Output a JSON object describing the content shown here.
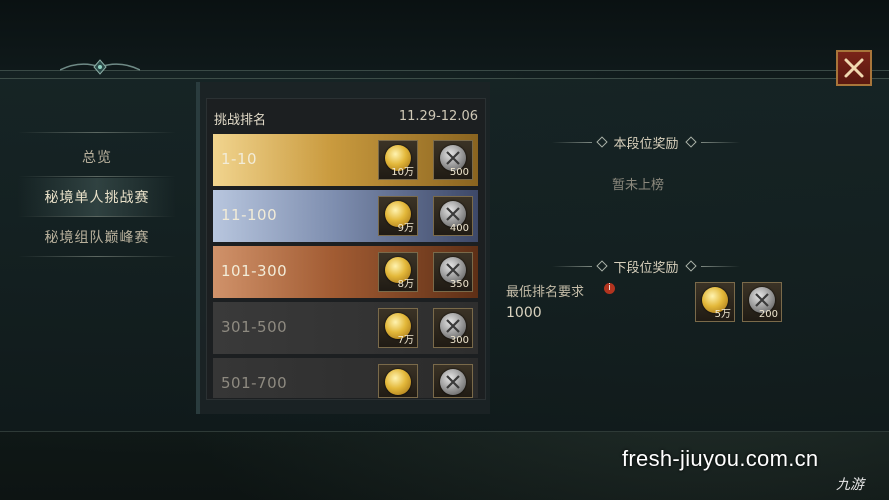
{
  "sidebar": {
    "items": [
      {
        "label": "总览",
        "active": false
      },
      {
        "label": "秘境单人挑战赛",
        "active": true
      },
      {
        "label": "秘境组队巅峰赛",
        "active": false
      }
    ]
  },
  "ranking": {
    "header_title": "挑战排名",
    "date_range": "11.29-12.06",
    "rows": [
      {
        "range": "1-10",
        "gold": "10万",
        "medal": "500"
      },
      {
        "range": "11-100",
        "gold": "9万",
        "medal": "400"
      },
      {
        "range": "101-300",
        "gold": "8万",
        "medal": "350"
      },
      {
        "range": "301-500",
        "gold": "7万",
        "medal": "300"
      },
      {
        "range": "501-700",
        "gold": "",
        "medal": ""
      }
    ]
  },
  "current_tier": {
    "title": "本段位奖励",
    "status": "暂未上榜"
  },
  "next_tier": {
    "title": "下段位奖励",
    "requirement_label": "最低排名要求",
    "info_icon": "i",
    "requirement_value": "1000",
    "gold": "5万",
    "medal": "200"
  },
  "close_icon": "close-icon",
  "watermark": {
    "url": "fresh-jiuyou.com.cn",
    "logo": "九游"
  },
  "colors": {
    "gold_tier": "#c99a3e",
    "silver_tier": "#7f8fb0",
    "bronze_tier": "#a25c33",
    "close_bg": "#7a2418",
    "close_border": "#a8753a"
  }
}
